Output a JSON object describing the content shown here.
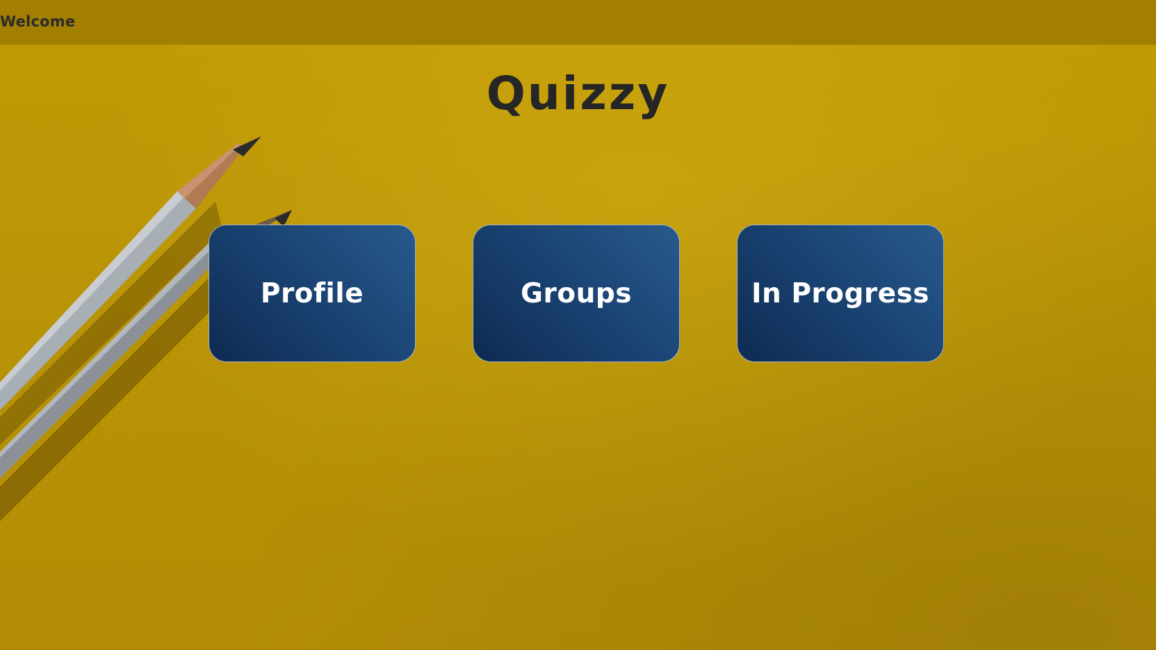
{
  "window": {
    "title": "Welcome"
  },
  "app": {
    "title": "Quizzy"
  },
  "tiles": [
    {
      "label": "Profile"
    },
    {
      "label": "Groups"
    },
    {
      "label": "In Progress"
    }
  ],
  "colors": {
    "background": "#b99406",
    "titlebar": "#a27f01",
    "tile": "#1b4575",
    "tile_text": "#ffffff",
    "title_text": "#262626"
  }
}
